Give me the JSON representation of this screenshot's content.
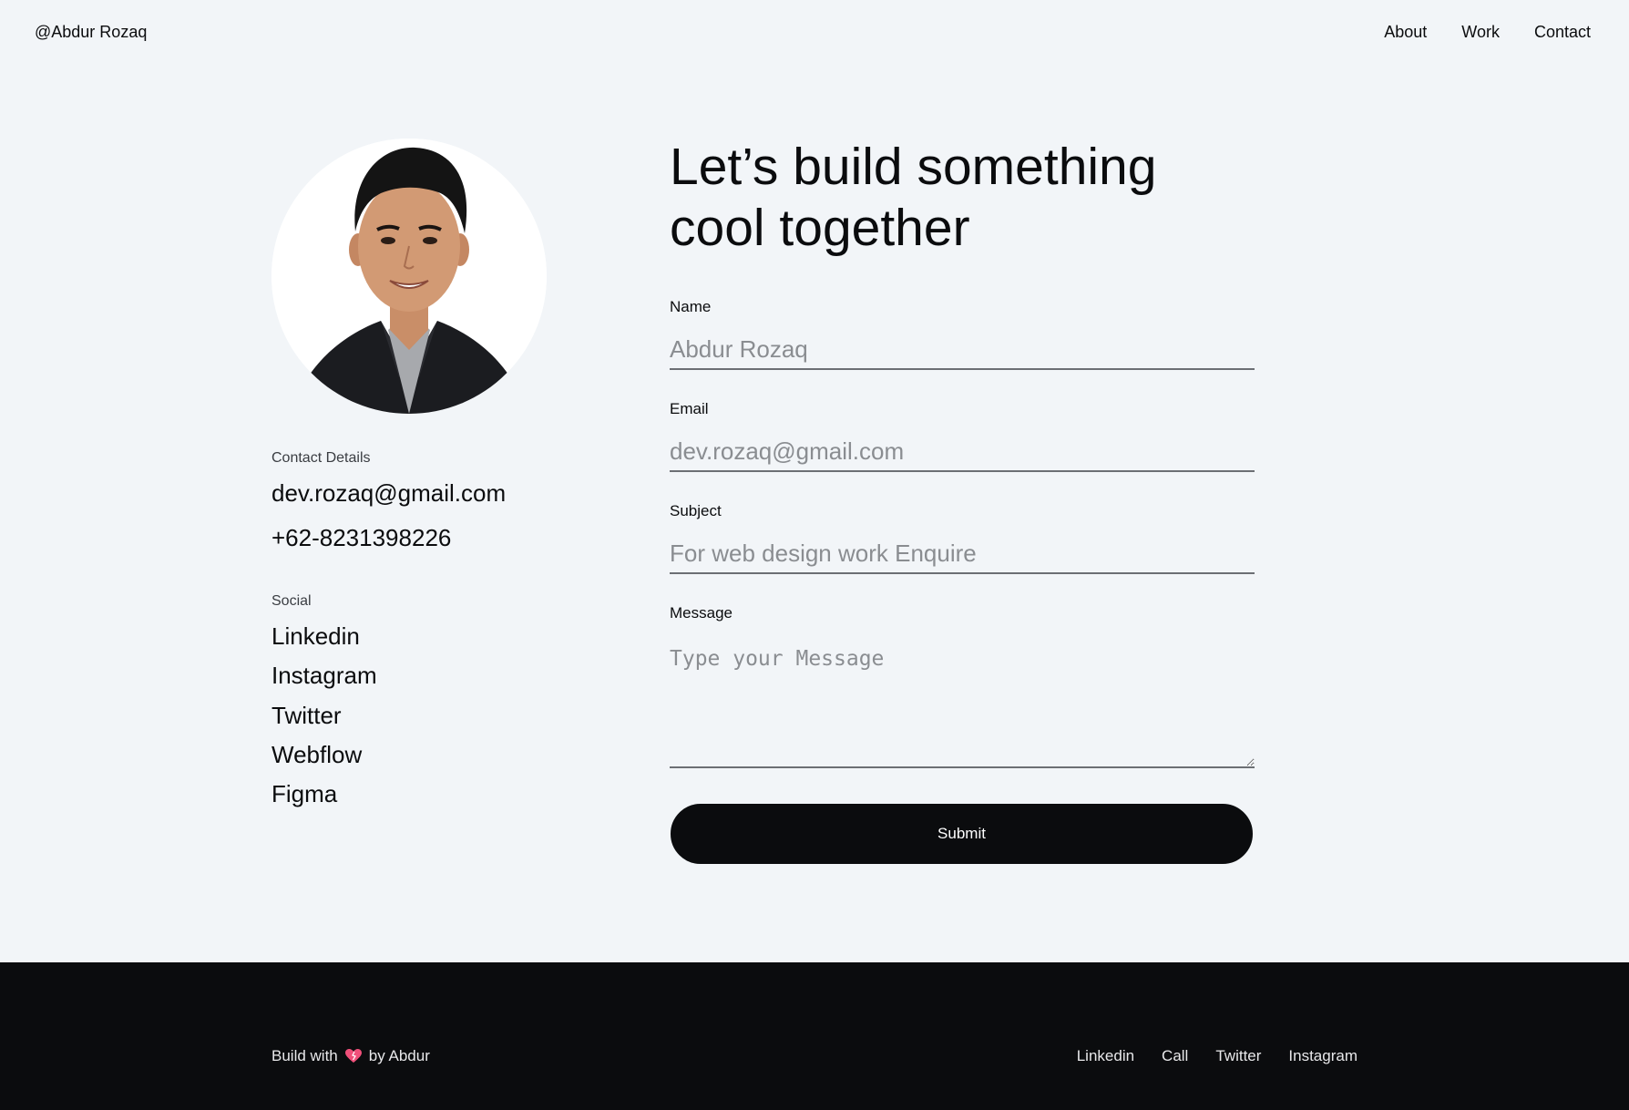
{
  "header": {
    "brand": "@Abdur Rozaq",
    "nav": [
      {
        "label": "About"
      },
      {
        "label": "Work"
      },
      {
        "label": "Contact"
      }
    ]
  },
  "profile": {
    "avatar_icon": "profile-photo"
  },
  "contact": {
    "label": "Contact Details",
    "email": "dev.rozaq@gmail.com",
    "phone": "+62-8231398226"
  },
  "social": {
    "label": "Social",
    "links": [
      "Linkedin",
      "Instagram",
      "Twitter",
      "Webflow",
      "Figma"
    ]
  },
  "form": {
    "headline": "Let’s build something cool together",
    "name": {
      "label": "Name",
      "placeholder": "Abdur Rozaq"
    },
    "email": {
      "label": "Email",
      "placeholder": "dev.rozaq@gmail.com"
    },
    "subject": {
      "label": "Subject",
      "placeholder": "For web design work Enquire"
    },
    "message": {
      "label": "Message",
      "placeholder": "Type your Message"
    },
    "submit_label": "Submit"
  },
  "footer": {
    "credit_prefix": "Build with",
    "credit_suffix": "by Abdur",
    "credit_icon": "heart-icon",
    "links": [
      "Linkedin",
      "Call",
      "Twitter",
      "Instagram"
    ]
  },
  "colors": {
    "background": "#f2f5f8",
    "text": "#0b0c0e",
    "footer_bg": "#0b0c0e",
    "accent_heart": "#f0507a"
  }
}
